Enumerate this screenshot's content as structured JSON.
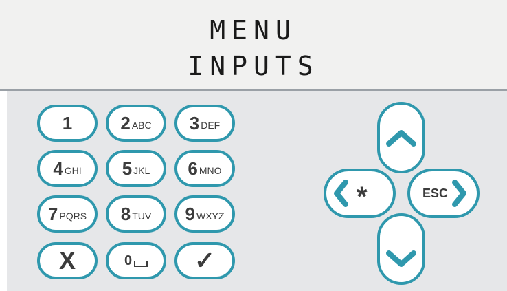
{
  "display": {
    "line1": "MENU",
    "line2": "INPUTS"
  },
  "keypad": {
    "keys": [
      {
        "num": "1",
        "letters": ""
      },
      {
        "num": "2",
        "letters": "ABC"
      },
      {
        "num": "3",
        "letters": "DEF"
      },
      {
        "num": "4",
        "letters": "GHI"
      },
      {
        "num": "5",
        "letters": "JKL"
      },
      {
        "num": "6",
        "letters": "MNO"
      },
      {
        "num": "7",
        "letters": "PQRS"
      },
      {
        "num": "8",
        "letters": "TUV"
      },
      {
        "num": "9",
        "letters": "WXYZ"
      },
      {
        "num": "0",
        "letters": ""
      }
    ],
    "cancel_label": "X",
    "confirm_label": "✓"
  },
  "nav": {
    "star_label": "*",
    "esc_label": "ESC"
  },
  "colors": {
    "accent": "#2f98ad",
    "text": "#3c3c3c",
    "display_bg": "#f1f1f0",
    "pad_bg": "#e6e7e9"
  }
}
